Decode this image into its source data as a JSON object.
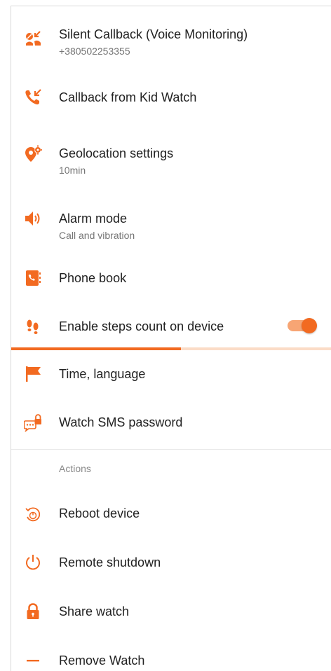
{
  "colors": {
    "accent": "#f26a21",
    "accent_light": "#f7a574",
    "text": "#212121",
    "subtext": "#757575"
  },
  "settings": [
    {
      "icon": "silent-callback-icon",
      "title": "Silent Callback (Voice Monitoring)",
      "subtitle": "+380502253355"
    },
    {
      "icon": "callback-icon",
      "title": "Callback from Kid Watch"
    },
    {
      "icon": "geolocation-gear-icon",
      "title": "Geolocation settings",
      "subtitle": "10min"
    },
    {
      "icon": "speaker-icon",
      "title": "Alarm mode",
      "subtitle": "Call and vibration"
    },
    {
      "icon": "phone-book-icon",
      "title": "Phone book"
    },
    {
      "icon": "footsteps-icon",
      "title": "Enable steps count on device",
      "toggle_on": true
    },
    {
      "icon": "flag-icon",
      "title": "Time, language"
    },
    {
      "icon": "sms-lock-icon",
      "title": "Watch SMS password"
    }
  ],
  "progress": {
    "value": 0.53
  },
  "actions": {
    "label": "Actions",
    "items": [
      {
        "icon": "reboot-icon",
        "title": "Reboot device"
      },
      {
        "icon": "power-icon",
        "title": "Remote shutdown"
      },
      {
        "icon": "lock-icon",
        "title": "Share watch"
      },
      {
        "icon": "minus-icon",
        "title": "Remove Watch"
      }
    ]
  }
}
